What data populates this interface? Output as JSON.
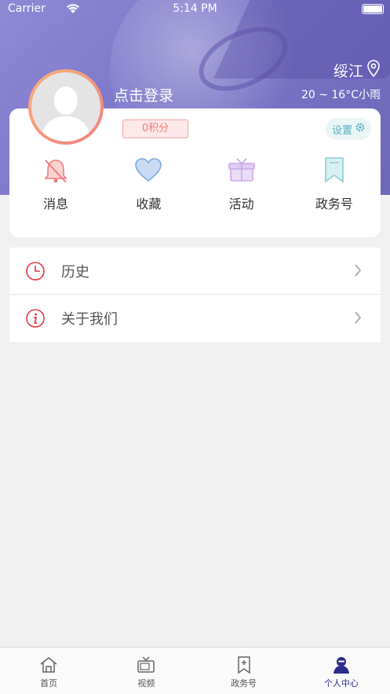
{
  "status_bar": {
    "carrier": "Carrier",
    "time": "5:14 PM"
  },
  "header": {
    "location": "绥江",
    "weather": "20 ~ 16°C小雨",
    "login_text": "点击登录",
    "points": "0积分",
    "settings_label": "设置"
  },
  "quick_actions": [
    {
      "label": "消息",
      "icon": "bell-icon",
      "color": "#f07c7c"
    },
    {
      "label": "收藏",
      "icon": "heart-icon",
      "color": "#7fa8e0"
    },
    {
      "label": "活动",
      "icon": "gift-icon",
      "color": "#c9a9e8"
    },
    {
      "label": "政务号",
      "icon": "bookmark-icon",
      "color": "#8ccfd6"
    }
  ],
  "menu": [
    {
      "label": "历史",
      "icon": "clock-icon"
    },
    {
      "label": "关于我们",
      "icon": "info-icon"
    }
  ],
  "tabbar": [
    {
      "label": "首页",
      "icon": "home-icon"
    },
    {
      "label": "视频",
      "icon": "tv-icon"
    },
    {
      "label": "政务号",
      "icon": "bookmark-plus-icon"
    },
    {
      "label": "个人中心",
      "icon": "person-icon",
      "active": true
    }
  ],
  "colors": {
    "accent": "#2c2a8c",
    "hero": "#7b76c8",
    "points": "#f27b7b",
    "settings": "#4fb2c1",
    "menu_icon": "#e03b3b"
  }
}
